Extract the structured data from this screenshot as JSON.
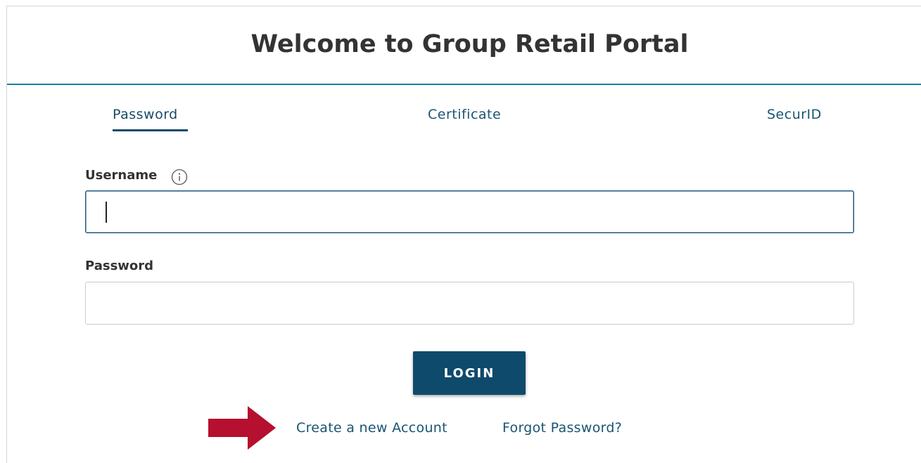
{
  "header": {
    "title": "Welcome to Group Retail Portal"
  },
  "tabs": [
    {
      "label": "Password",
      "active": true
    },
    {
      "label": "Certificate",
      "active": false
    },
    {
      "label": "SecurID",
      "active": false
    }
  ],
  "form": {
    "username_label": "Username",
    "username_value": "",
    "password_label": "Password",
    "password_value": "",
    "info_icon": "info-icon"
  },
  "actions": {
    "login_label": "LOGIN",
    "create_account_label": "Create a new Account",
    "forgot_password_label": "Forgot Password?"
  },
  "annotation": {
    "arrow_icon": "arrow-right-icon",
    "arrow_color": "#b5102f"
  },
  "colors": {
    "accent": "#0e4a6b",
    "link": "#1a5471",
    "header_rule": "#1b7fa3"
  }
}
